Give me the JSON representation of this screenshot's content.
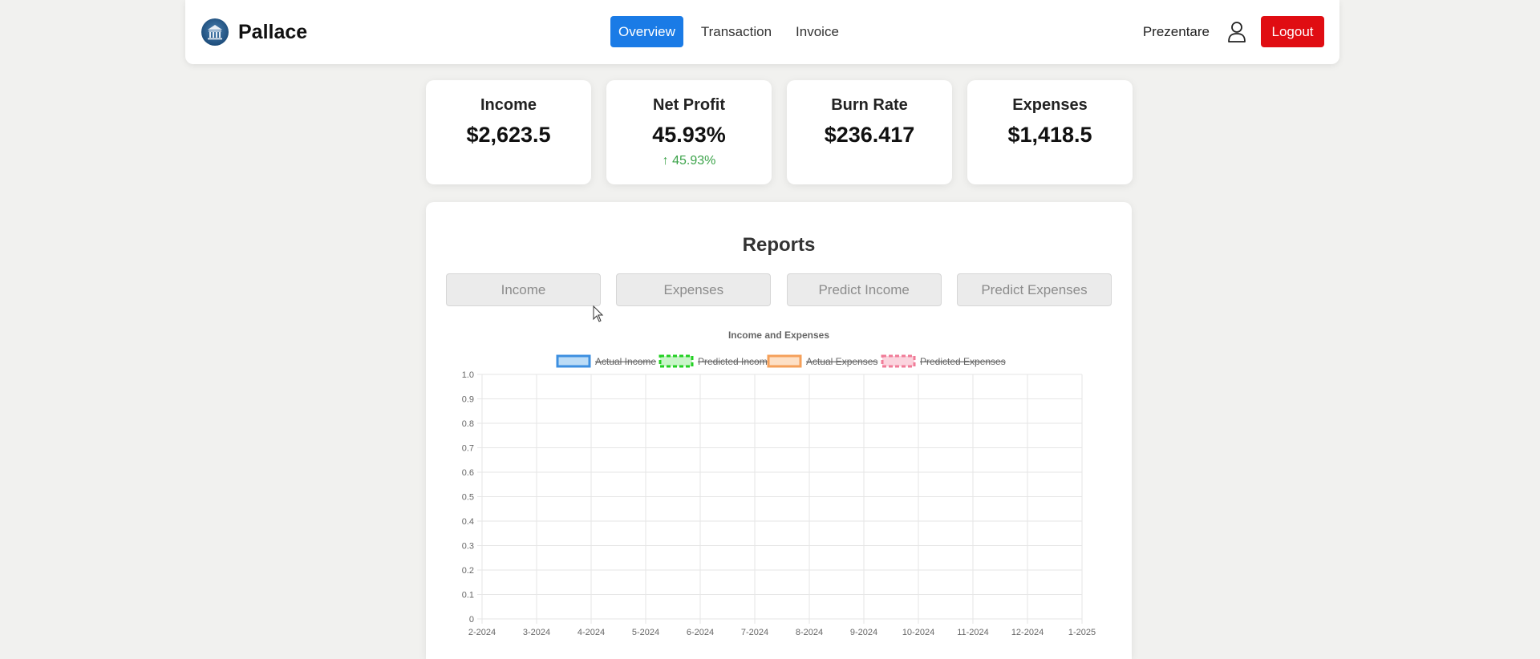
{
  "nav": {
    "brand": "Pallace",
    "links": [
      {
        "label": "Overview",
        "active": true
      },
      {
        "label": "Transaction",
        "active": false
      },
      {
        "label": "Invoice",
        "active": false
      }
    ],
    "user_name": "Prezentare",
    "logout_label": "Logout"
  },
  "cards": [
    {
      "title": "Income",
      "value": "$2,623.5",
      "change": ""
    },
    {
      "title": "Net Profit",
      "value": "45.93%",
      "change": "↑ 45.93%"
    },
    {
      "title": "Burn Rate",
      "value": "$236.417",
      "change": ""
    },
    {
      "title": "Expenses",
      "value": "$1,418.5",
      "change": ""
    }
  ],
  "reports": {
    "title": "Reports",
    "tabs": [
      "Income",
      "Expenses",
      "Predict Income",
      "Predict Expenses"
    ]
  },
  "colors": {
    "primary": "#1a7be6",
    "logout": "#e00d12",
    "positive": "#3ca34a"
  },
  "chart_data": {
    "type": "line",
    "title": "Income and Expenses",
    "categories": [
      "2-2024",
      "3-2024",
      "4-2024",
      "5-2024",
      "6-2024",
      "7-2024",
      "8-2024",
      "9-2024",
      "10-2024",
      "11-2024",
      "12-2024",
      "1-2025"
    ],
    "series": [
      {
        "name": "Actual Income",
        "values": [],
        "hidden": true,
        "color": "#3d8fe0",
        "fill": "#bcdcf6",
        "dashed": false
      },
      {
        "name": "Predicted Income",
        "values": [],
        "hidden": true,
        "color": "#22d022",
        "fill": "#c8f5c8",
        "dashed": true
      },
      {
        "name": "Actual Expenses",
        "values": [],
        "hidden": true,
        "color": "#f5a05a",
        "fill": "#fde0c6",
        "dashed": false
      },
      {
        "name": "Predicted Expenses",
        "values": [],
        "hidden": true,
        "color": "#f07c98",
        "fill": "#fbd4de",
        "dashed": true
      }
    ],
    "ylim": [
      0,
      1.0
    ],
    "yticks": [
      "0",
      "0.1",
      "0.2",
      "0.3",
      "0.4",
      "0.5",
      "0.6",
      "0.7",
      "0.8",
      "0.9",
      "1.0"
    ],
    "grid": true,
    "legend": "top"
  }
}
